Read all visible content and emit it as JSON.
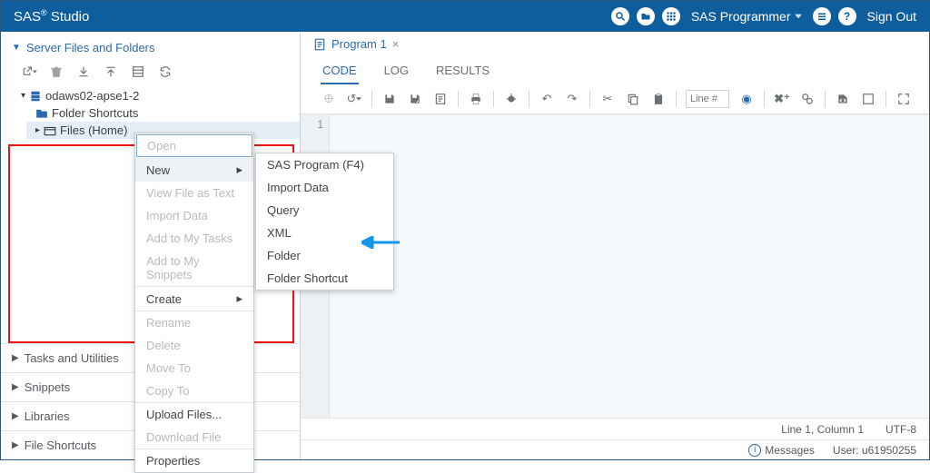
{
  "header": {
    "title_pre": "SAS",
    "title_post": " Studio",
    "user": "SAS Programmer",
    "signout": "Sign Out"
  },
  "sidebar": {
    "panel_title": "Server Files and Folders",
    "tree": {
      "server": "odaws02-apse1-2",
      "shortcuts": "Folder Shortcuts",
      "home": "Files (Home)"
    },
    "sections": [
      "Tasks and Utilities",
      "Snippets",
      "Libraries",
      "File Shortcuts"
    ]
  },
  "ctx1": {
    "open": "Open",
    "new": "New",
    "view": "View File as Text",
    "import": "Import Data",
    "add_tasks": "Add to My Tasks",
    "add_snip": "Add to My Snippets",
    "create": "Create",
    "rename": "Rename",
    "delete": "Delete",
    "moveto": "Move To",
    "copyto": "Copy To",
    "upload": "Upload Files...",
    "download": "Download File",
    "props": "Properties"
  },
  "ctx2": {
    "sas": "SAS Program (F4)",
    "import": "Import Data",
    "query": "Query",
    "xml": "XML",
    "folder": "Folder",
    "shortcut": "Folder Shortcut"
  },
  "editor": {
    "tab": "Program 1",
    "subtabs": {
      "code": "CODE",
      "log": "LOG",
      "results": "RESULTS"
    },
    "line_placeholder": "Line #",
    "gutter1": "1"
  },
  "status": {
    "pos": "Line 1, Column 1",
    "enc": "UTF-8"
  },
  "footer": {
    "messages": "Messages",
    "user": "User: u61950255"
  }
}
